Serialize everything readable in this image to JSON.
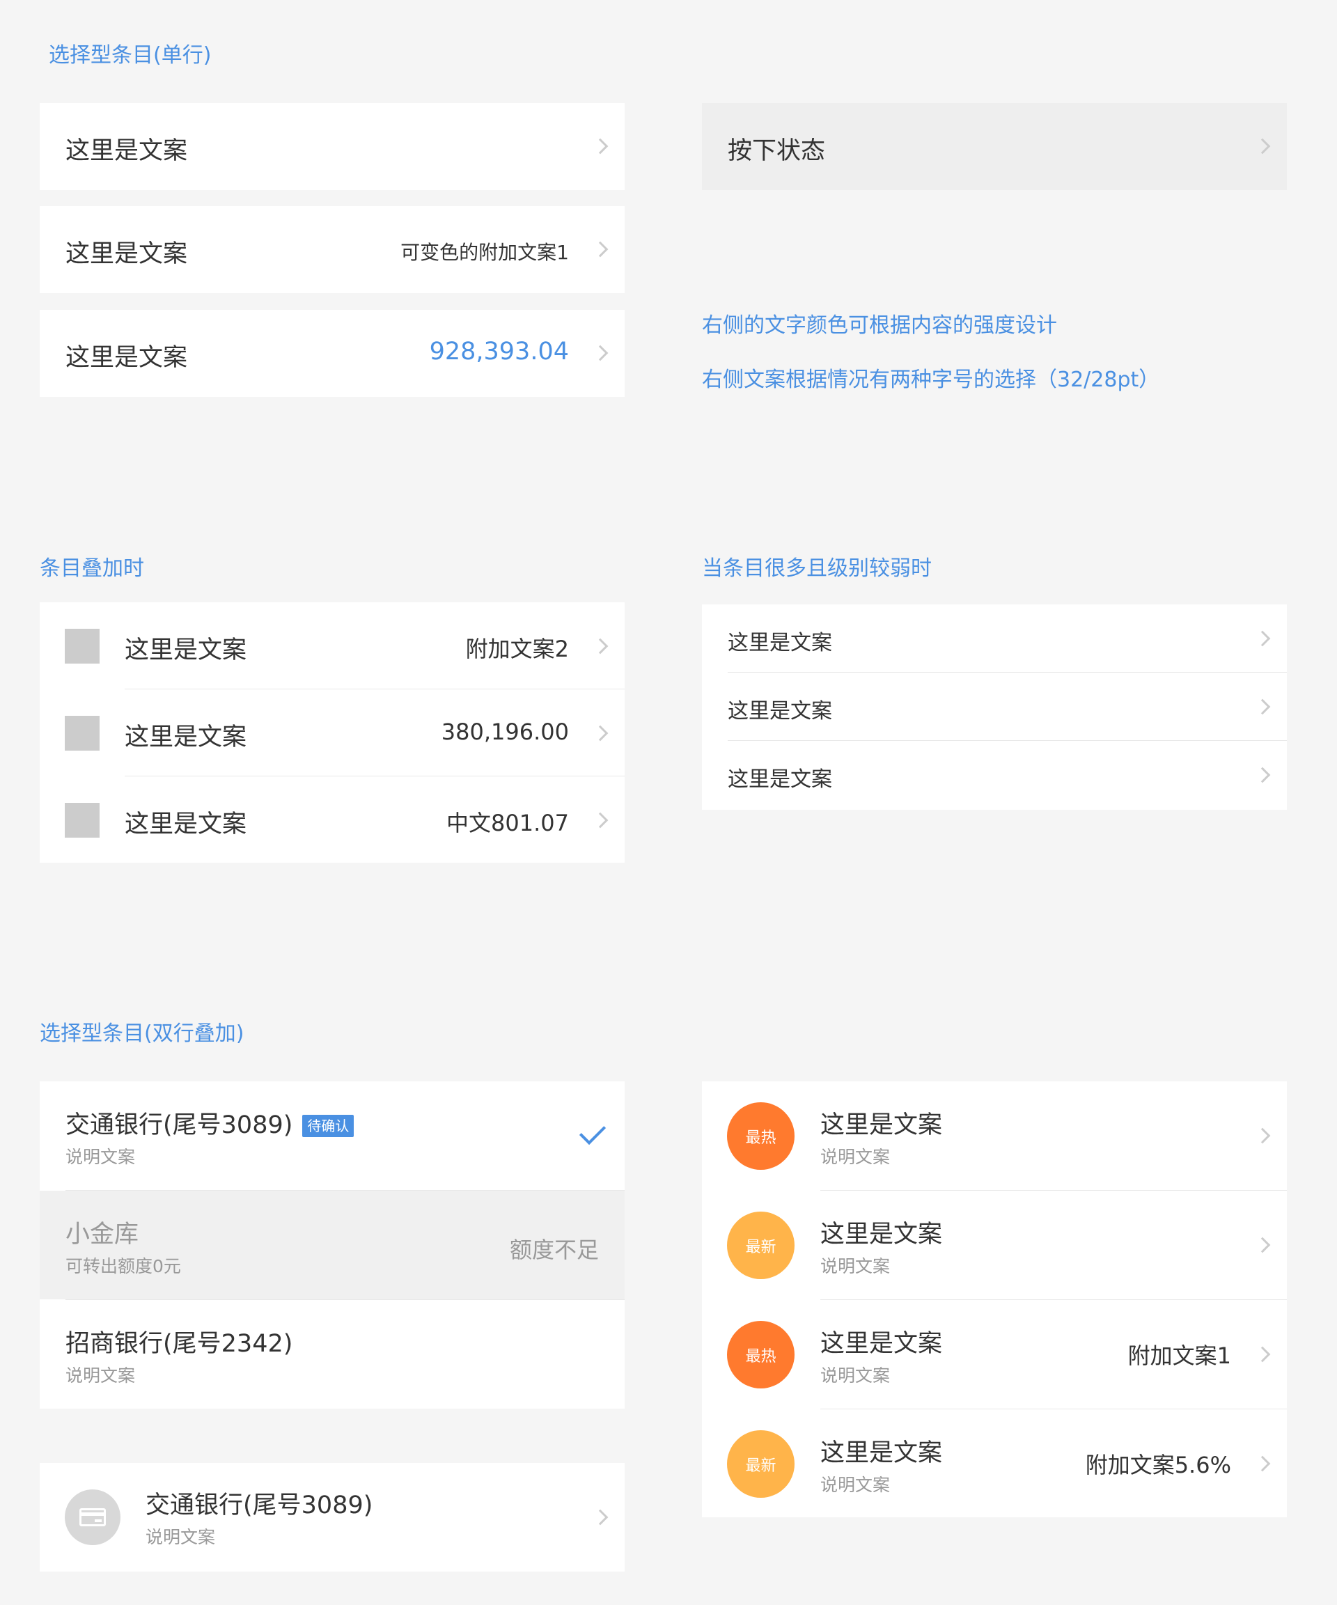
{
  "sections": {
    "single_line": {
      "title": "选择型条目(单行)",
      "rows": [
        {
          "label": "这里是文案"
        },
        {
          "label": "这里是文案",
          "extra": "可变色的附加文案1"
        },
        {
          "label": "这里是文案",
          "extra": "928,393.04"
        }
      ],
      "pressed": {
        "label": "按下状态"
      },
      "notes": [
        "右侧的文字颜色可根据内容的强度设计",
        "右侧文案根据情况有两种字号的选择（32/28pt）"
      ]
    },
    "stacked": {
      "title": "条目叠加时",
      "rows": [
        {
          "label": "这里是文案",
          "extra": "附加文案2"
        },
        {
          "label": "这里是文案",
          "extra": "380,196.00"
        },
        {
          "label": "这里是文案",
          "extra": "中文801.07"
        }
      ]
    },
    "weak": {
      "title": "当条目很多且级别较弱时",
      "rows": [
        {
          "label": "这里是文案"
        },
        {
          "label": "这里是文案"
        },
        {
          "label": "这里是文案"
        }
      ]
    },
    "double": {
      "title": "选择型条目(双行叠加)",
      "accounts": [
        {
          "title": "交通银行(尾号3089)",
          "badge": "待确认",
          "sub": "说明文案",
          "selected": true
        },
        {
          "title": "小金库",
          "sub": "可转出额度0元",
          "extra": "额度不足",
          "disabled": true
        },
        {
          "title": "招商银行(尾号2342)",
          "sub": "说明文案"
        }
      ],
      "bank_row": {
        "title": "交通银行(尾号3089)",
        "sub": "说明文案",
        "icon": "bank-card-icon"
      },
      "tag_rows": [
        {
          "tag": "最热",
          "title": "这里是文案",
          "sub": "说明文案",
          "extra": ""
        },
        {
          "tag": "最新",
          "title": "这里是文案",
          "sub": "说明文案",
          "extra": ""
        },
        {
          "tag": "最热",
          "title": "这里是文案",
          "sub": "说明文案",
          "extra": "附加文案1"
        },
        {
          "tag": "最新",
          "title": "这里是文案",
          "sub": "说明文案",
          "extra": "附加文案5.6%"
        }
      ]
    }
  },
  "colors": {
    "accent": "#4a90e2",
    "hot": "#ff7a2e",
    "new": "#ffb44a",
    "background": "#f5f5f5"
  }
}
